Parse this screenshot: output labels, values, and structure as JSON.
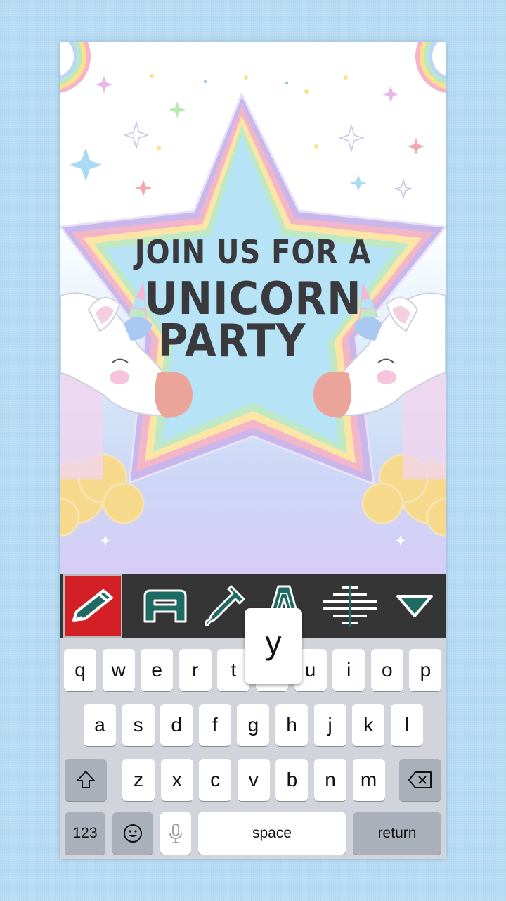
{
  "invitation": {
    "line1": "JOIN US FOR A",
    "line2": "UNICORN",
    "line3": "PARTY"
  },
  "toolbar": {
    "tools": [
      "pencil-icon",
      "font-icon",
      "eyedropper-icon",
      "text-style-icon",
      "align-icon",
      "collapse-icon"
    ],
    "accent": "#d32027",
    "icon_color": "#1f6b63"
  },
  "keyboard": {
    "popup_key": "y",
    "row1": [
      "q",
      "w",
      "e",
      "r",
      "t",
      "y",
      "u",
      "i",
      "o",
      "p"
    ],
    "row2": [
      "a",
      "s",
      "d",
      "f",
      "g",
      "h",
      "j",
      "k",
      "l"
    ],
    "row3": [
      "z",
      "x",
      "c",
      "v",
      "b",
      "n",
      "m"
    ],
    "numbers_label": "123",
    "space_label": "space",
    "return_label": "return"
  }
}
